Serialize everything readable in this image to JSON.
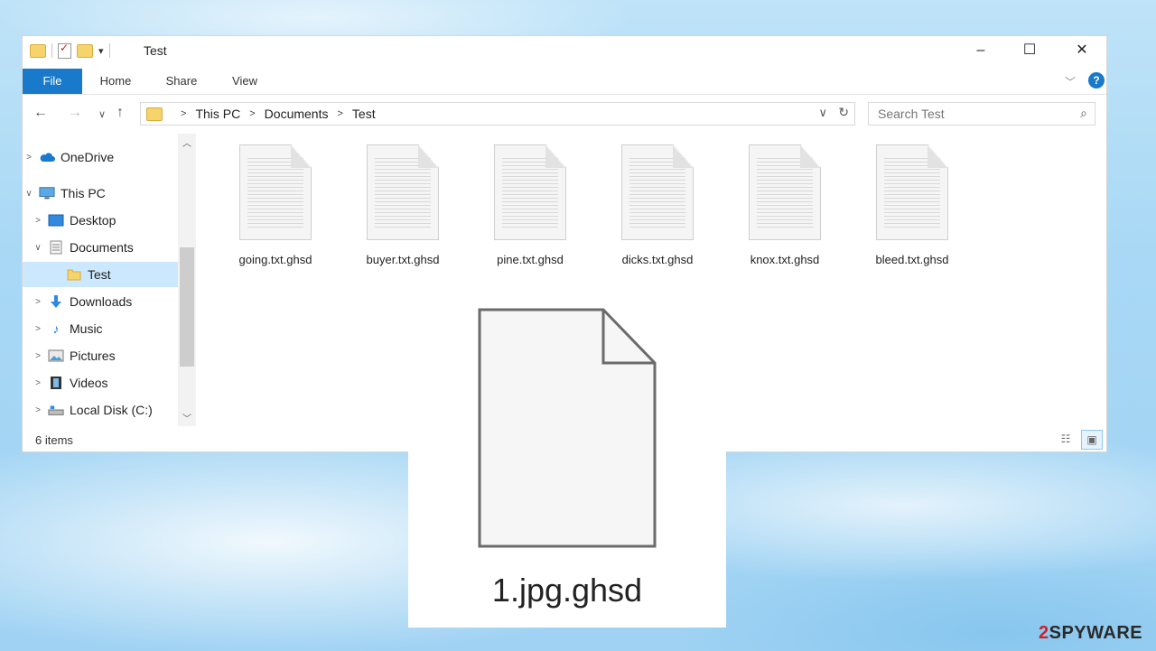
{
  "window": {
    "title": "Test",
    "controls": {
      "minimize": "–",
      "maximize": "☐",
      "close": "✕"
    }
  },
  "ribbon": {
    "tabs": [
      {
        "label": "File"
      },
      {
        "label": "Home"
      },
      {
        "label": "Share"
      },
      {
        "label": "View"
      }
    ]
  },
  "address": {
    "crumbs": [
      "This PC",
      "Documents",
      "Test"
    ]
  },
  "search": {
    "placeholder": "Search Test"
  },
  "nav": {
    "items": [
      {
        "label": "OneDrive",
        "icon": "cloud-icon",
        "expand": "right"
      },
      {
        "label": "This PC",
        "icon": "computer-icon",
        "expand": "down"
      },
      {
        "label": "Desktop",
        "icon": "desktop-icon",
        "expand": "right"
      },
      {
        "label": "Documents",
        "icon": "documents-icon",
        "expand": "down"
      },
      {
        "label": "Test",
        "icon": "folder-icon",
        "expand": "none",
        "selected": true
      },
      {
        "label": "Downloads",
        "icon": "download-icon",
        "expand": "right"
      },
      {
        "label": "Music",
        "icon": "music-icon",
        "expand": "right"
      },
      {
        "label": "Pictures",
        "icon": "pictures-icon",
        "expand": "right"
      },
      {
        "label": "Videos",
        "icon": "videos-icon",
        "expand": "right"
      },
      {
        "label": "Local Disk (C:)",
        "icon": "drive-icon",
        "expand": "right"
      }
    ]
  },
  "files": [
    {
      "name": "going.txt.ghsd"
    },
    {
      "name": "buyer.txt.ghsd"
    },
    {
      "name": "pine.txt.ghsd"
    },
    {
      "name": "dicks.txt.ghsd"
    },
    {
      "name": "knox.txt.ghsd"
    },
    {
      "name": "bleed.txt.ghsd"
    }
  ],
  "status": {
    "count": "6 items"
  },
  "overlay": {
    "filename": "1.jpg.ghsd"
  },
  "watermark": {
    "prefix": "2",
    "text": "SPYWARE"
  },
  "colors": {
    "accent": "#1979ca",
    "selection": "#cce8ff",
    "folder": "#f6d36b"
  }
}
